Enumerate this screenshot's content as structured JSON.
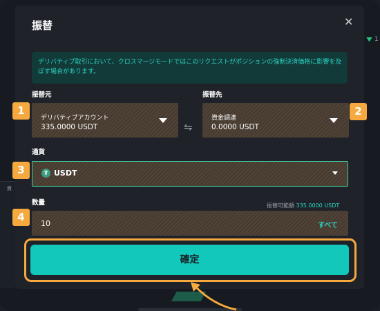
{
  "modal": {
    "title": "振替",
    "close_icon": "close-icon",
    "notice": "デリバティブ取引において、クロスマージモードではこのリクエストがポジションの強制決済価格に影響を及ぼす場合があります。"
  },
  "from": {
    "label": "振替元",
    "account": "デリバティブアカウント",
    "balance": "335.0000 USDT"
  },
  "to": {
    "label": "振替先",
    "account": "資金調達",
    "balance": "0.0000 USDT"
  },
  "swap_icon": "swap-arrows-icon",
  "currency": {
    "label": "通貨",
    "icon": "tether-icon",
    "value": "USDT"
  },
  "amount": {
    "label": "数量",
    "available_label": "振替可能額",
    "available_value": "335.0000 USDT",
    "value": "10",
    "all_button": "すべて"
  },
  "confirm_button": "確定",
  "steps": [
    "1",
    "2",
    "3",
    "4"
  ],
  "background": {
    "right_text": "1",
    "left_tab": "資"
  },
  "colors": {
    "accent": "#12c8bb",
    "highlight": "#f5a93e",
    "field": "#4a3d32",
    "notice_text": "#2bd4c2"
  }
}
